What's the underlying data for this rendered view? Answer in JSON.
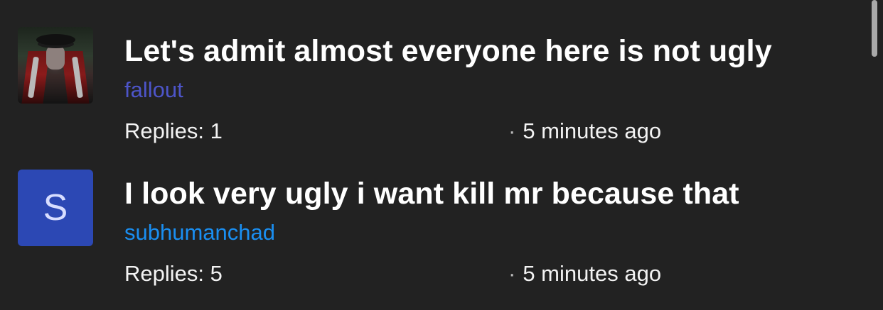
{
  "threads": [
    {
      "title": "Let's admit almost everyone here is not ugly",
      "author": "fallout",
      "replies_label": "Replies:",
      "replies_count": "1",
      "time_dot": "·",
      "time": "5 minutes ago",
      "avatar": {
        "type": "image",
        "icon": "anime-character-avatar-icon"
      }
    },
    {
      "title": "I look very ugly i want kill mr because that",
      "author": "subhumanchad",
      "replies_label": "Replies:",
      "replies_count": "5",
      "time_dot": "·",
      "time": "5 minutes ago",
      "avatar": {
        "type": "letter",
        "letter": "S"
      }
    }
  ],
  "colors": {
    "background": "#222222",
    "title": "#ffffff",
    "author_1": "#4d55c9",
    "author_2": "#1a8ff2",
    "avatar_letter_bg": "#2c48b4",
    "avatar_letter_fg": "#d7ddff",
    "scrollbar": "#a9a9a9"
  }
}
